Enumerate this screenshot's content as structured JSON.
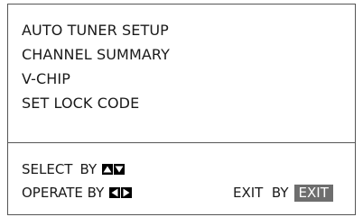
{
  "menu": {
    "items": [
      {
        "label": "AUTO TUNER SETUP"
      },
      {
        "label": "CHANNEL SUMMARY"
      },
      {
        "label": "V-CHIP"
      },
      {
        "label": "SET LOCK CODE"
      }
    ]
  },
  "footer": {
    "select_label": "SELECT",
    "select_by": "BY",
    "select_keys": [
      "up-arrow-icon",
      "down-arrow-icon"
    ],
    "operate_label": "OPERATE BY",
    "operate_keys": [
      "left-arrow-icon",
      "right-arrow-icon"
    ],
    "exit_label": "EXIT  BY",
    "exit_key": "EXIT"
  },
  "colors": {
    "key_fill": "#000000",
    "exit_badge": "#6e6e6e",
    "text": "#1a1a1a"
  }
}
